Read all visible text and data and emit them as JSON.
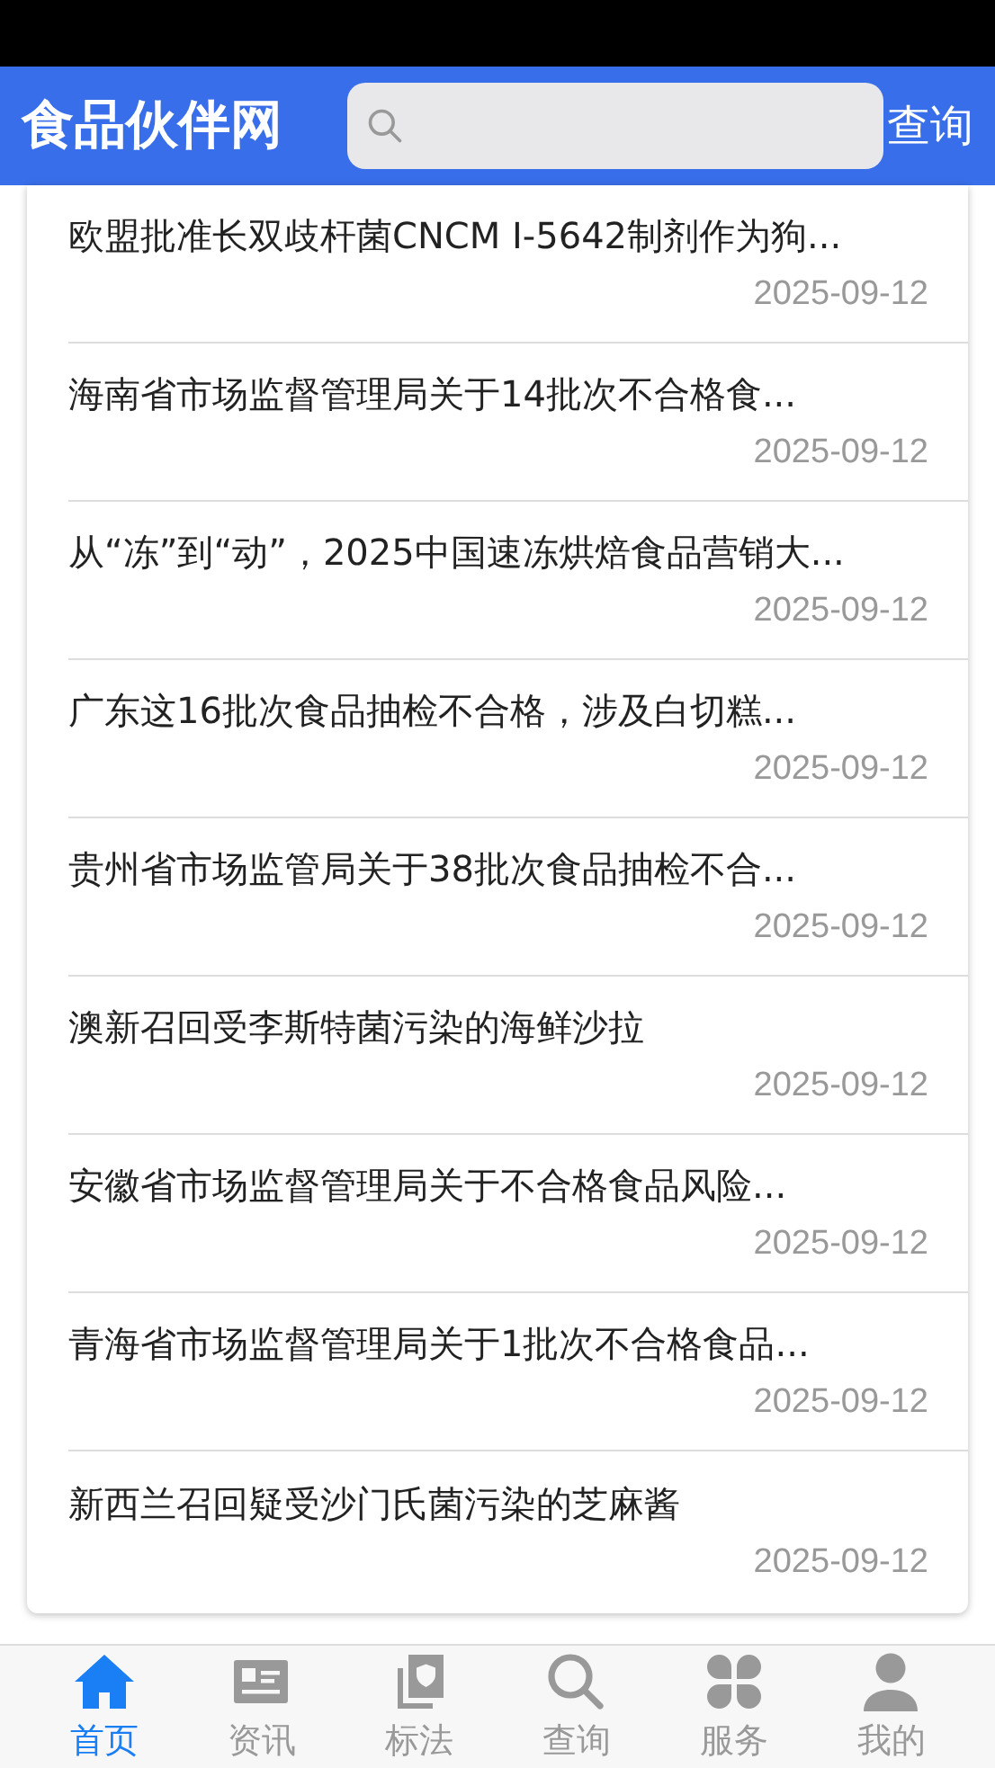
{
  "header": {
    "logo": "食品伙伴网",
    "search_button": "查询"
  },
  "news": [
    {
      "title": "欧盟批准长双歧杆菌CNCM I-5642制剂作为狗...",
      "date": "2025-09-12"
    },
    {
      "title": "海南省市场监督管理局关于14批次不合格食...",
      "date": "2025-09-12"
    },
    {
      "title": "从“冻”到“动”，2025中国速冻烘焙食品营销大...",
      "date": "2025-09-12"
    },
    {
      "title": "广东这16批次食品抽检不合格，涉及白切糕...",
      "date": "2025-09-12"
    },
    {
      "title": "贵州省市场监管局关于38批次食品抽检不合...",
      "date": "2025-09-12"
    },
    {
      "title": "澳新召回受李斯特菌污染的海鲜沙拉",
      "date": "2025-09-12"
    },
    {
      "title": "安徽省市场监督管理局关于不合格食品风险...",
      "date": "2025-09-12"
    },
    {
      "title": "青海省市场监督管理局关于1批次不合格食品...",
      "date": "2025-09-12"
    },
    {
      "title": "新西兰召回疑受沙门氏菌污染的芝麻酱",
      "date": "2025-09-12"
    }
  ],
  "tabs": [
    {
      "label": "首页",
      "kind": "home",
      "selected": true
    },
    {
      "label": "资讯",
      "kind": "news",
      "selected": false
    },
    {
      "label": "标法",
      "kind": "standard",
      "selected": false
    },
    {
      "label": "查询",
      "kind": "search",
      "selected": false
    },
    {
      "label": "服务",
      "kind": "service",
      "selected": false
    },
    {
      "label": "我的",
      "kind": "user",
      "selected": false
    }
  ]
}
